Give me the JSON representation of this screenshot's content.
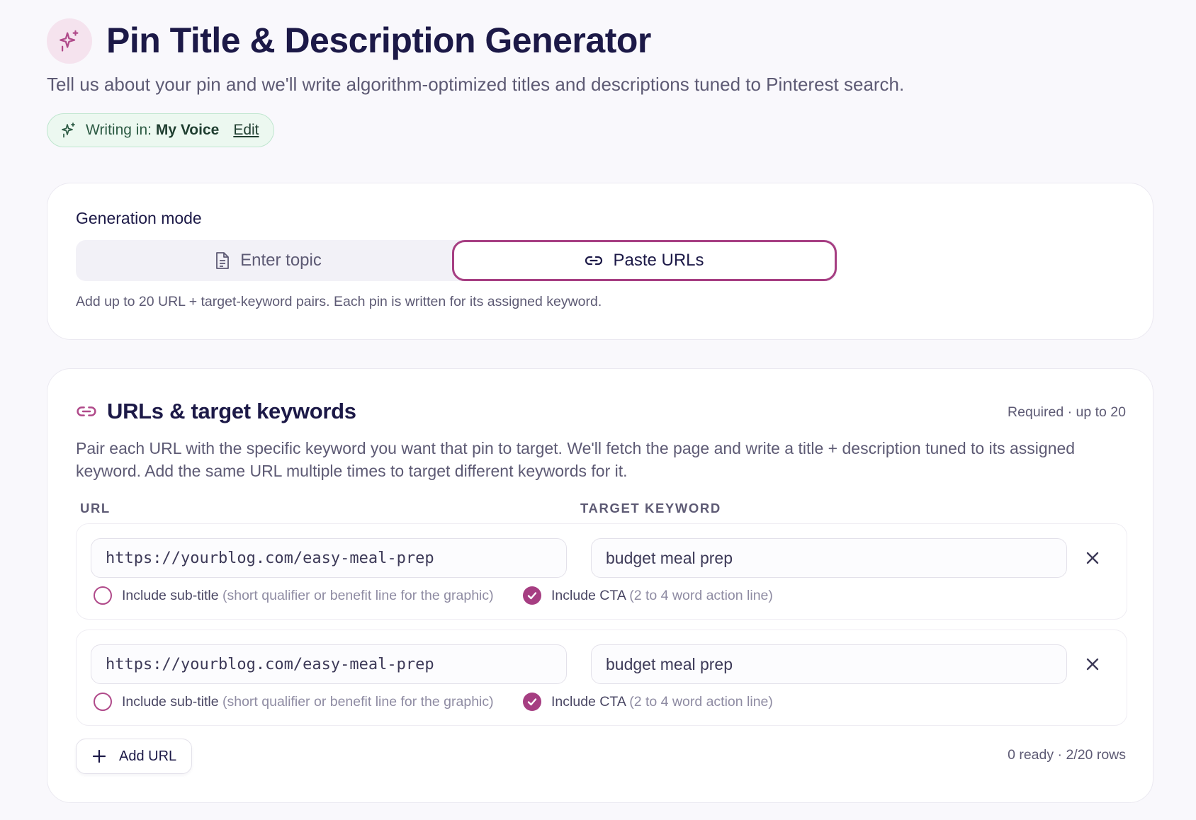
{
  "header": {
    "title": "Pin Title & Description Generator",
    "subtitle": "Tell us about your pin and we'll write algorithm-optimized titles and descriptions tuned to Pinterest search.",
    "voice": {
      "prefix": "Writing in:",
      "name": "My Voice",
      "edit": "Edit"
    }
  },
  "generation": {
    "label": "Generation mode",
    "modes": [
      {
        "label": "Enter topic",
        "icon": "document-icon",
        "selected": false
      },
      {
        "label": "Paste URLs",
        "icon": "link-icon",
        "selected": true
      }
    ],
    "hint": "Add up to 20 URL + target-keyword pairs. Each pin is written for its assigned keyword."
  },
  "urls": {
    "title": "URLs & target keywords",
    "required": "Required · up to 20",
    "description": "Pair each URL with the specific keyword you want that pin to target. We'll fetch the page and write a title + description tuned to its assigned keyword. Add the same URL multiple times to target different keywords for it.",
    "col_url": "URL",
    "col_keyword": "TARGET KEYWORD",
    "rows": [
      {
        "url": "https://yourblog.com/easy-meal-prep",
        "keyword": "budget meal prep",
        "subtitle_label": "Include sub-title",
        "subtitle_hint": "(short qualifier or benefit line for the graphic)",
        "subtitle_checked": false,
        "cta_label": "Include CTA",
        "cta_hint": "(2 to 4 word action line)",
        "cta_checked": true
      },
      {
        "url": "https://yourblog.com/easy-meal-prep",
        "keyword": "budget meal prep",
        "subtitle_label": "Include sub-title",
        "subtitle_hint": "(short qualifier or benefit line for the graphic)",
        "subtitle_checked": false,
        "cta_label": "Include CTA",
        "cta_hint": "(2 to 4 word action line)",
        "cta_checked": true
      }
    ],
    "add_label": "Add URL",
    "status": "0 ready · 2/20 rows"
  },
  "colors": {
    "accent": "#a63e82",
    "title": "#1c1947",
    "muted": "#5d5a74",
    "voice_bg": "#ecf8f0"
  }
}
